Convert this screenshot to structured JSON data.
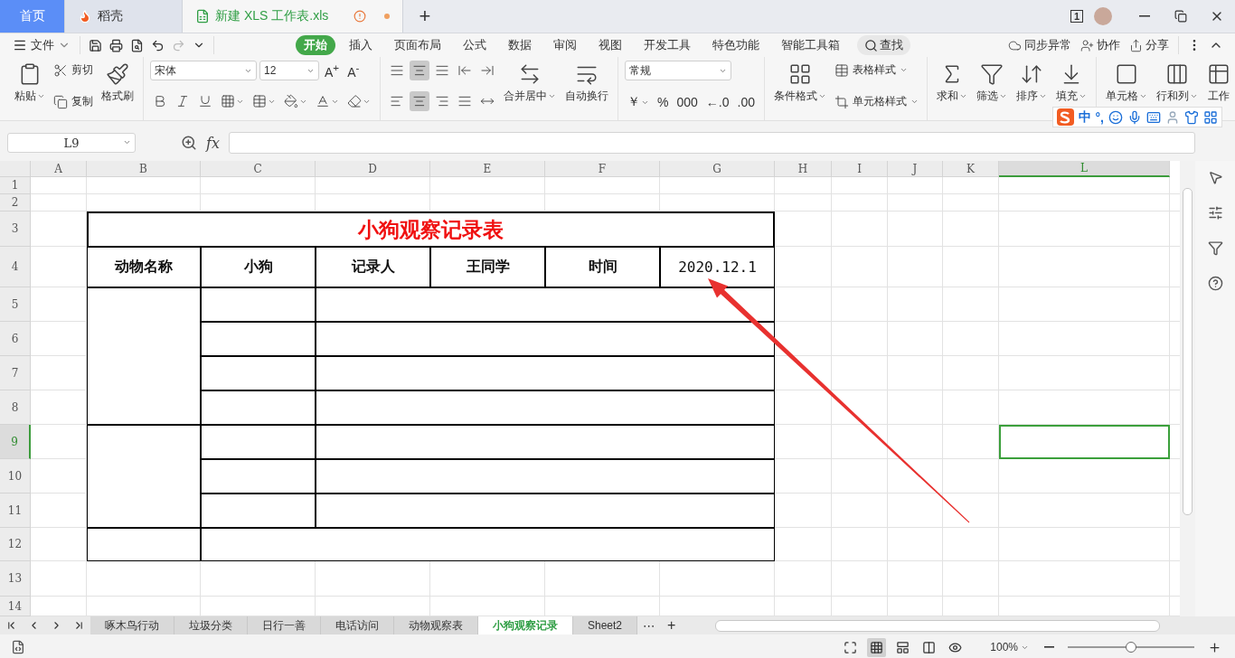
{
  "titlebar": {
    "tabs": [
      {
        "kind": "home",
        "label": "首页",
        "selected": false
      },
      {
        "kind": "docer",
        "label": "稻壳",
        "selected": false
      },
      {
        "kind": "sheet",
        "label": "新建 XLS 工作表.xls",
        "selected": true,
        "unsaved": true
      }
    ],
    "new_tab": "+",
    "window_count": "1"
  },
  "menu": {
    "file": "文件",
    "tabs": [
      {
        "label": "开始",
        "selected": true
      },
      {
        "label": "插入",
        "selected": false
      },
      {
        "label": "页面布局",
        "selected": false
      },
      {
        "label": "公式",
        "selected": false
      },
      {
        "label": "数据",
        "selected": false
      },
      {
        "label": "审阅",
        "selected": false
      },
      {
        "label": "视图",
        "selected": false
      },
      {
        "label": "开发工具",
        "selected": false
      },
      {
        "label": "特色功能",
        "selected": false
      },
      {
        "label": "智能工具箱",
        "selected": false
      }
    ],
    "search": "查找",
    "actions": [
      {
        "kind": "cloud",
        "label": "同步异常"
      },
      {
        "kind": "collab",
        "label": "协作"
      },
      {
        "kind": "share",
        "label": "分享"
      }
    ]
  },
  "ribbon": [
    {
      "columns": [
        [
          {
            "kind": "big",
            "label": "粘贴",
            "dropdown": true
          }
        ],
        [
          {
            "kind": "small",
            "label": "剪切"
          },
          {
            "kind": "small",
            "label": "复制"
          }
        ],
        [
          {
            "kind": "big",
            "label": "格式刷",
            "dropdown": false
          }
        ]
      ]
    },
    {
      "columns": [
        [
          {
            "kind": "row",
            "items": [
              {
                "kind": "select",
                "value": "宋体"
              },
              {
                "kind": "select",
                "value": "12"
              },
              {
                "kind": "glyph",
                "label": "A$^{+}$"
              },
              {
                "kind": "glyph",
                "label": "A$^{-}$"
              }
            ]
          },
          {
            "kind": "row",
            "items": [
              {
                "kind": "icon",
                "pressed": false
              },
              {
                "kind": "icon",
                "pressed": false
              },
              {
                "kind": "icon",
                "pressed": false
              },
              {
                "kind": "icon",
                "pressed": false,
                "dropdown": true
              },
              {
                "kind": "icon",
                "pressed": false,
                "dropdown": true
              },
              {
                "kind": "icon",
                "pressed": false,
                "dropdown": true
              },
              {
                "kind": "icon",
                "pressed": false,
                "dropdown": true
              },
              {
                "kind": "icon",
                "pressed": false,
                "dropdown": true
              }
            ]
          }
        ]
      ]
    },
    {
      "columns": [
        [
          {
            "kind": "row",
            "items": [
              {
                "kind": "icon",
                "pressed": false
              },
              {
                "kind": "icon",
                "pressed": true
              },
              {
                "kind": "icon",
                "pressed": false
              },
              {
                "kind": "icon",
                "pressed": false
              },
              {
                "kind": "icon",
                "pressed": false
              }
            ]
          },
          {
            "kind": "row",
            "items": [
              {
                "kind": "icon",
                "pressed": false
              },
              {
                "kind": "icon",
                "pressed": true
              },
              {
                "kind": "icon",
                "pressed": false
              },
              {
                "kind": "icon",
                "pressed": false
              },
              {
                "kind": "icon",
                "pressed": false
              }
            ]
          }
        ],
        [
          {
            "kind": "big",
            "label": "合并居中",
            "dropdown": true
          }
        ],
        [
          {
            "kind": "big",
            "label": "自动换行",
            "dropdown": false
          }
        ]
      ]
    },
    {
      "columns": [
        [
          {
            "kind": "row",
            "items": [
              {
                "kind": "select",
                "value": "常规"
              }
            ]
          },
          {
            "kind": "row",
            "items": [
              {
                "kind": "glyph",
                "label": "￥",
                "dropdown": true
              },
              {
                "kind": "glyph",
                "label": "%"
              },
              {
                "kind": "glyph",
                "label": "000"
              },
              {
                "kind": "glyph",
                "label": "←.0"
              },
              {
                "kind": "glyph",
                "label": ".00"
              }
            ]
          }
        ]
      ]
    },
    {
      "columns": [
        [
          {
            "kind": "big",
            "label": "条件格式",
            "dropdown": true
          }
        ],
        [
          {
            "kind": "small",
            "label": "表格样式",
            "dropdown": true
          },
          {
            "kind": "small",
            "label": "单元格样式",
            "dropdown": true
          }
        ]
      ]
    },
    {
      "columns": [
        [
          {
            "kind": "big",
            "label": "求和",
            "dropdown": true
          }
        ],
        [
          {
            "kind": "big",
            "label": "筛选",
            "dropdown": true
          }
        ],
        [
          {
            "kind": "big",
            "label": "排序",
            "dropdown": true
          }
        ],
        [
          {
            "kind": "big",
            "label": "填充",
            "dropdown": true
          }
        ]
      ]
    },
    {
      "columns": [
        [
          {
            "kind": "big",
            "label": "单元格",
            "dropdown": true
          }
        ],
        [
          {
            "kind": "big",
            "label": "行和列",
            "dropdown": true
          }
        ],
        [
          {
            "kind": "big",
            "label": "工作",
            "dropdown": false
          }
        ]
      ]
    }
  ],
  "ime": {
    "mode": "中",
    "punctuation": "°,"
  },
  "formula_bar": {
    "name_box": "L9",
    "fx": "fx"
  },
  "columns": [
    {
      "label": "A",
      "selected": false
    },
    {
      "label": "B",
      "selected": false
    },
    {
      "label": "C",
      "selected": false
    },
    {
      "label": "D",
      "selected": false
    },
    {
      "label": "E",
      "selected": false
    },
    {
      "label": "F",
      "selected": false
    },
    {
      "label": "G",
      "selected": false
    },
    {
      "label": "H",
      "selected": false
    },
    {
      "label": "I",
      "selected": false
    },
    {
      "label": "J",
      "selected": false
    },
    {
      "label": "K",
      "selected": false
    },
    {
      "label": "L",
      "selected": true
    }
  ],
  "rows": [
    {
      "label": "1",
      "selected": false
    },
    {
      "label": "2",
      "selected": false
    },
    {
      "label": "3",
      "selected": false
    },
    {
      "label": "4",
      "selected": false
    },
    {
      "label": "5",
      "selected": false
    },
    {
      "label": "6",
      "selected": false
    },
    {
      "label": "7",
      "selected": false
    },
    {
      "label": "8",
      "selected": false
    },
    {
      "label": "9",
      "selected": true
    },
    {
      "label": "10",
      "selected": false
    },
    {
      "label": "11",
      "selected": false
    },
    {
      "label": "12",
      "selected": false
    },
    {
      "label": "13",
      "selected": false
    },
    {
      "label": "14",
      "selected": false
    }
  ],
  "table": {
    "title": "小狗观察记录表",
    "header": [
      "动物名称",
      "小狗",
      "记录人",
      "王同学",
      "时间",
      "2020.12.1"
    ]
  },
  "sheets": [
    {
      "label": "啄木鸟行动",
      "selected": false
    },
    {
      "label": "垃圾分类",
      "selected": false
    },
    {
      "label": "日行一善",
      "selected": false
    },
    {
      "label": "电话访问",
      "selected": false
    },
    {
      "label": "动物观察表",
      "selected": false
    },
    {
      "label": "小狗观察记录",
      "selected": true
    },
    {
      "label": "Sheet2",
      "selected": false
    }
  ],
  "sheet_more": "⋯",
  "sheet_add": "+",
  "status": {
    "zoom": "100%",
    "level": 0.5
  }
}
